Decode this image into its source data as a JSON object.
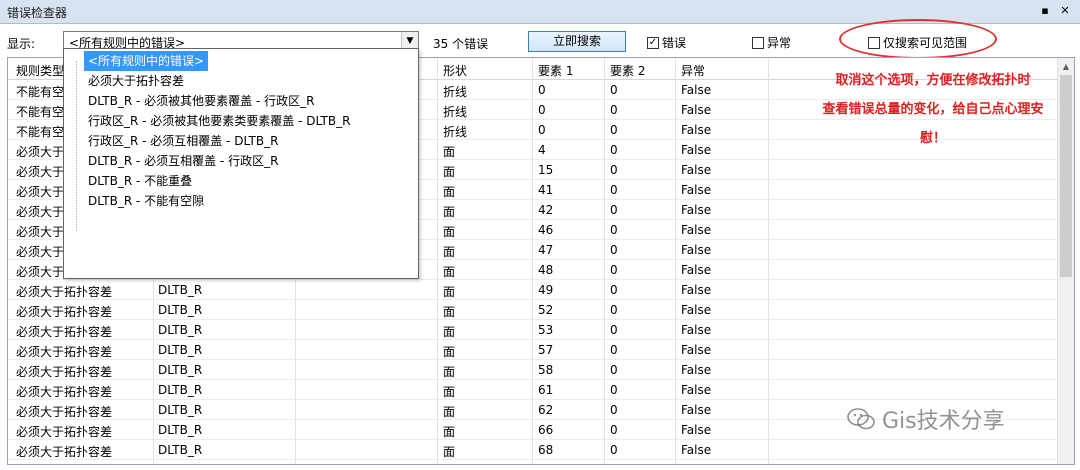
{
  "window": {
    "title": "错误检查器",
    "pin_icon": "pin-icon",
    "close_icon": "close-icon"
  },
  "toolbar": {
    "show_label": "显示:",
    "combo_value": "<所有规则中的错误>",
    "error_count": "35 个错误",
    "search_button": "立即搜索",
    "errors_checkbox": {
      "label": "错误",
      "checked": true
    },
    "exceptions_checkbox": {
      "label": "异常",
      "checked": false
    },
    "visible_only_checkbox": {
      "label": "仅搜索可见范围",
      "checked": false
    }
  },
  "dropdown": {
    "items": [
      {
        "label": "<所有规则中的错误>",
        "selected": true
      },
      {
        "label": "必须大于拓扑容差",
        "selected": false
      },
      {
        "label": "DLTB_R - 必须被其他要素覆盖 - 行政区_R",
        "selected": false
      },
      {
        "label": "行政区_R - 必须被其他要素类要素覆盖 - DLTB_R",
        "selected": false
      },
      {
        "label": "行政区_R - 必须互相覆盖 - DLTB_R",
        "selected": false
      },
      {
        "label": "DLTB_R - 必须互相覆盖 - 行政区_R",
        "selected": false
      },
      {
        "label": "DLTB_R - 不能重叠",
        "selected": false
      },
      {
        "label": "DLTB_R - 不能有空隙",
        "selected": false
      }
    ]
  },
  "grid": {
    "columns": [
      "规则类型",
      "",
      "",
      "形状",
      "要素 1",
      "要素 2",
      "异常"
    ],
    "rows": [
      [
        "不能有空",
        "",
        "",
        "折线",
        "0",
        "0",
        "False"
      ],
      [
        "不能有空",
        "",
        "",
        "折线",
        "0",
        "0",
        "False"
      ],
      [
        "不能有空",
        "",
        "",
        "折线",
        "0",
        "0",
        "False"
      ],
      [
        "必须大于",
        "",
        "",
        "面",
        "4",
        "0",
        "False"
      ],
      [
        "必须大于",
        "",
        "",
        "面",
        "15",
        "0",
        "False"
      ],
      [
        "必须大于",
        "",
        "",
        "面",
        "41",
        "0",
        "False"
      ],
      [
        "必须大于",
        "",
        "",
        "面",
        "42",
        "0",
        "False"
      ],
      [
        "必须大于",
        "",
        "",
        "面",
        "46",
        "0",
        "False"
      ],
      [
        "必须大于",
        "",
        "",
        "面",
        "47",
        "0",
        "False"
      ],
      [
        "必须大于",
        "",
        "",
        "面",
        "48",
        "0",
        "False"
      ],
      [
        "必须大于拓扑容差",
        "DLTB_R",
        "",
        "面",
        "49",
        "0",
        "False"
      ],
      [
        "必须大于拓扑容差",
        "DLTB_R",
        "",
        "面",
        "52",
        "0",
        "False"
      ],
      [
        "必须大于拓扑容差",
        "DLTB_R",
        "",
        "面",
        "53",
        "0",
        "False"
      ],
      [
        "必须大于拓扑容差",
        "DLTB_R",
        "",
        "面",
        "57",
        "0",
        "False"
      ],
      [
        "必须大于拓扑容差",
        "DLTB_R",
        "",
        "面",
        "58",
        "0",
        "False"
      ],
      [
        "必须大于拓扑容差",
        "DLTB_R",
        "",
        "面",
        "61",
        "0",
        "False"
      ],
      [
        "必须大于拓扑容差",
        "DLTB_R",
        "",
        "面",
        "62",
        "0",
        "False"
      ],
      [
        "必须大于拓扑容差",
        "DLTB_R",
        "",
        "面",
        "66",
        "0",
        "False"
      ],
      [
        "必须大于拓扑容差",
        "DLTB_R",
        "",
        "面",
        "68",
        "0",
        "False"
      ]
    ]
  },
  "annotation": {
    "lines": [
      "取消这个选项，方便在修改拓扑时",
      "查看错误总量的变化，给自己点心理安",
      "慰！"
    ],
    "color": "#e02020"
  },
  "watermark": {
    "text": "Gis技术分享",
    "icon": "wechat-icon"
  },
  "colors": {
    "selection": "#3399ff",
    "titlebar": "#d7e3f1",
    "ellipse": "#e03030"
  }
}
